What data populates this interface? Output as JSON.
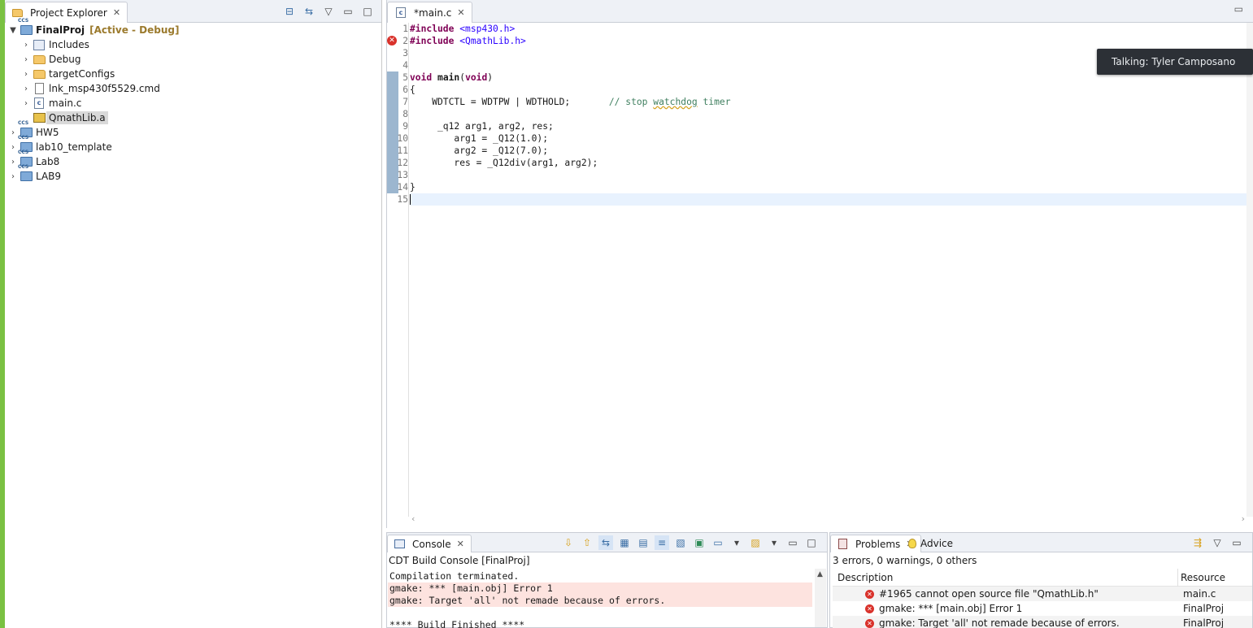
{
  "explorer": {
    "tab_label": "Project Explorer",
    "tree": [
      {
        "label": "FinalProj",
        "meta": "[Active - Debug]",
        "level": 0,
        "expanded": true,
        "icon": "ccs-project-icon"
      },
      {
        "label": "Includes",
        "level": 1,
        "icon": "includes-icon"
      },
      {
        "label": "Debug",
        "level": 1,
        "icon": "folder-icon"
      },
      {
        "label": "targetConfigs",
        "level": 1,
        "icon": "folder-icon"
      },
      {
        "label": "lnk_msp430f5529.cmd",
        "level": 1,
        "icon": "text-file-icon"
      },
      {
        "label": "main.c",
        "level": 1,
        "icon": "c-file-icon"
      },
      {
        "label": "QmathLib.a",
        "level": 1,
        "icon": "library-file-icon",
        "selected": true
      },
      {
        "label": "HW5",
        "level": 0,
        "icon": "ccs-project-icon"
      },
      {
        "label": "lab10_template",
        "level": 0,
        "icon": "ccs-project-icon"
      },
      {
        "label": "Lab8",
        "level": 0,
        "icon": "ccs-project-icon"
      },
      {
        "label": "LAB9",
        "level": 0,
        "icon": "ccs-project-icon"
      }
    ]
  },
  "editor": {
    "tab_label": "*main.c",
    "line_numbers": [
      "1",
      "2",
      "3",
      "4",
      "5",
      "6",
      "7",
      "8",
      "9",
      "10",
      "11",
      "12",
      "13",
      "14",
      "15"
    ],
    "error_line": 2
  },
  "notification": {
    "text": "Talking: Tyler Camposano"
  },
  "console": {
    "tab_label": "Console",
    "subtitle": "CDT Build Console [FinalProj]",
    "lines": [
      {
        "text": "Compilation terminated.",
        "error": false
      },
      {
        "text": "gmake: *** [main.obj] Error 1",
        "error": true
      },
      {
        "text": "gmake: Target 'all' not remade because of errors.",
        "error": true
      },
      {
        "text": "",
        "error": false
      },
      {
        "text": "**** Build Finished ****",
        "error": false
      }
    ]
  },
  "problems": {
    "tab_label": "Problems",
    "advice_label": "Advice",
    "summary": "3 errors, 0 warnings, 0 others",
    "columns": {
      "description": "Description",
      "resource": "Resource"
    },
    "rows": [
      {
        "description": "#1965 cannot open source file \"QmathLib.h\"",
        "resource": "main.c"
      },
      {
        "description": "gmake: *** [main.obj] Error 1",
        "resource": "FinalProj"
      },
      {
        "description": "gmake: Target 'all' not remade because of errors.",
        "resource": "FinalProj"
      }
    ]
  },
  "colors": {
    "accent_strip": "#7ac142",
    "keyword": "#7f0055",
    "string": "#2a00ff",
    "comment": "#3f7f5f",
    "error": "#d9322b"
  }
}
